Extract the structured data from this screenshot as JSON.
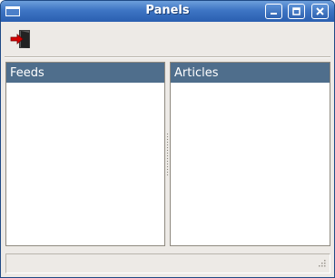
{
  "window": {
    "title": "Panels"
  },
  "toolbar": {
    "exit_icon": "exit-door-icon"
  },
  "panels": {
    "left": {
      "header": "Feeds",
      "items": []
    },
    "right": {
      "header": "Articles",
      "items": []
    }
  },
  "statusbar": {
    "text": ""
  },
  "colors": {
    "titlebar": "#3e75c4",
    "panel_header": "#4f6e8c",
    "window_bg": "#edeae6",
    "panel_bg": "#ffffff",
    "exit_arrow": "#d40000"
  }
}
